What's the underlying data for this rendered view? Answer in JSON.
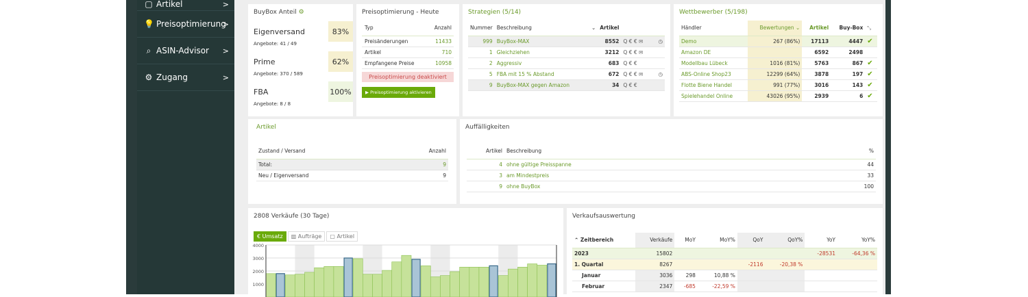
{
  "sidebar": {
    "items": [
      {
        "label": "Artikel",
        "icon": "box-icon"
      },
      {
        "label": "Preisoptimierung",
        "icon": "lightbulb-icon"
      },
      {
        "label": "ASIN-Advisor",
        "icon": "search-plus-icon"
      },
      {
        "label": "Zugang",
        "icon": "gear-icon"
      }
    ]
  },
  "buybox": {
    "title": "BuyBox Anteil",
    "rows": [
      {
        "label": "Eigenversand",
        "value": "83%",
        "sub": "Angebote: 41 / 49"
      },
      {
        "label": "Prime",
        "value": "62%",
        "sub": "Angebote: 370 / 589"
      },
      {
        "label": "FBA",
        "value": "100%",
        "sub": "Angebote: 8 / 8"
      }
    ]
  },
  "preisopt": {
    "title": "Preisoptimierung - Heute",
    "headers": [
      "Typ",
      "Anzahl"
    ],
    "rows": [
      {
        "typ": "Preisänderungen",
        "anzahl": "11433"
      },
      {
        "typ": "Artikel",
        "anzahl": "710"
      },
      {
        "typ": "Empfangene Preise",
        "anzahl": "10958"
      }
    ],
    "status": "Preisoptimierung deaktiviert",
    "button": "Preisoptimierung aktivieren"
  },
  "strategien": {
    "title": "Strategien (5/14)",
    "headers": [
      "Nummer",
      "Beschreibung",
      "Artikel"
    ],
    "rows": [
      {
        "nr": "999",
        "desc": "BuyBox-MAX",
        "artikel": "8552",
        "icons": "Q € € ✉",
        "clock": true
      },
      {
        "nr": "1",
        "desc": "Gleichziehen",
        "artikel": "3212",
        "icons": "Q € € ✉",
        "clock": false
      },
      {
        "nr": "2",
        "desc": "Aggressiv",
        "artikel": "683",
        "icons": "Q € €",
        "clock": false
      },
      {
        "nr": "5",
        "desc": "FBA mit 15 % Abstand",
        "artikel": "672",
        "icons": "Q € € ✉",
        "clock": true
      },
      {
        "nr": "9",
        "desc": "BuyBox-MAX gegen Amazon",
        "artikel": "34",
        "icons": "Q € €",
        "clock": false
      }
    ]
  },
  "wettbewerber": {
    "title": "Wettbewerber (5/198)",
    "headers": [
      "Händler",
      "Bewertungen",
      "Artikel",
      "Buy-Box"
    ],
    "rows": [
      {
        "h": "Demo",
        "bew": "267 (86%)",
        "art": "17113",
        "bb": "4447",
        "check": true
      },
      {
        "h": "Amazon DE",
        "bew": "",
        "art": "6592",
        "bb": "2498",
        "check": false
      },
      {
        "h": "Modellbau Lübeck",
        "bew": "1016 (81%)",
        "art": "5763",
        "bb": "867",
        "check": true
      },
      {
        "h": "ABS-Online Shop23",
        "bew": "12299 (64%)",
        "art": "3878",
        "bb": "197",
        "check": true
      },
      {
        "h": "Flotte Biene Handel",
        "bew": "991 (77%)",
        "art": "3016",
        "bb": "143",
        "check": true
      },
      {
        "h": "Spielehandel Online",
        "bew": "43026 (95%)",
        "art": "2939",
        "bb": "6",
        "check": true
      }
    ]
  },
  "artikel": {
    "title": "Artikel",
    "headers": [
      "Zustand / Versand",
      "Anzahl"
    ],
    "rows": [
      {
        "z": "Total:",
        "a": "9"
      },
      {
        "z": "Neu / Eigenversand",
        "a": "9"
      }
    ]
  },
  "auff": {
    "title": "Auffälligkeiten",
    "headers": [
      "Artikel",
      "Beschreibung",
      "%"
    ],
    "rows": [
      {
        "a": "4",
        "b": "ohne gültige Preisspanne",
        "p": "44"
      },
      {
        "a": "3",
        "b": "am Mindestpreis",
        "p": "33"
      },
      {
        "a": "9",
        "b": "ohne BuyBox",
        "p": "100"
      }
    ]
  },
  "verkaeufe": {
    "title": "2808 Verkäufe (30 Tage)",
    "tabs": [
      "€ Umsatz",
      "Aufträge",
      "Artikel"
    ]
  },
  "chart_data": {
    "type": "bar",
    "yticks": [
      "4000",
      "3000",
      "2000",
      "1000"
    ],
    "ylim": [
      0,
      4000
    ],
    "values": [
      1800,
      1800,
      1700,
      1750,
      1900,
      2250,
      2350,
      2350,
      3000,
      2950,
      1750,
      1750,
      2050,
      2700,
      3200,
      2900,
      2400,
      1550,
      1650,
      1950,
      2300,
      2300,
      2300,
      2400,
      1650,
      2150,
      2300,
      2550,
      2450,
      2550
    ],
    "highlight": [
      1,
      8,
      15,
      23,
      29
    ]
  },
  "verkaufsauswertung": {
    "title": "Verkaufsauswertung",
    "headers": [
      "Zeitbereich",
      "Verkäufe",
      "MoY",
      "MoY%",
      "QoY",
      "QoY%",
      "YoY",
      "YoY%"
    ],
    "rows": [
      {
        "z": "2023",
        "v": "15802",
        "moy": "",
        "moyp": "",
        "qoy": "",
        "qoyp": "",
        "yoy": "-28531",
        "yoyp": "-64,36 %"
      },
      {
        "z": "1. Quartal",
        "v": "8267",
        "moy": "",
        "moyp": "",
        "qoy": "-2116",
        "qoyp": "-20,38 %",
        "yoy": "",
        "yoyp": ""
      },
      {
        "z": "Januar",
        "v": "3036",
        "moy": "298",
        "moyp": "10,88 %",
        "qoy": "",
        "qoyp": "",
        "yoy": "",
        "yoyp": ""
      },
      {
        "z": "Februar",
        "v": "2347",
        "moy": "-685",
        "moyp": "-22,59 %",
        "qoy": "",
        "qoyp": "",
        "yoy": "",
        "yoyp": ""
      }
    ]
  }
}
